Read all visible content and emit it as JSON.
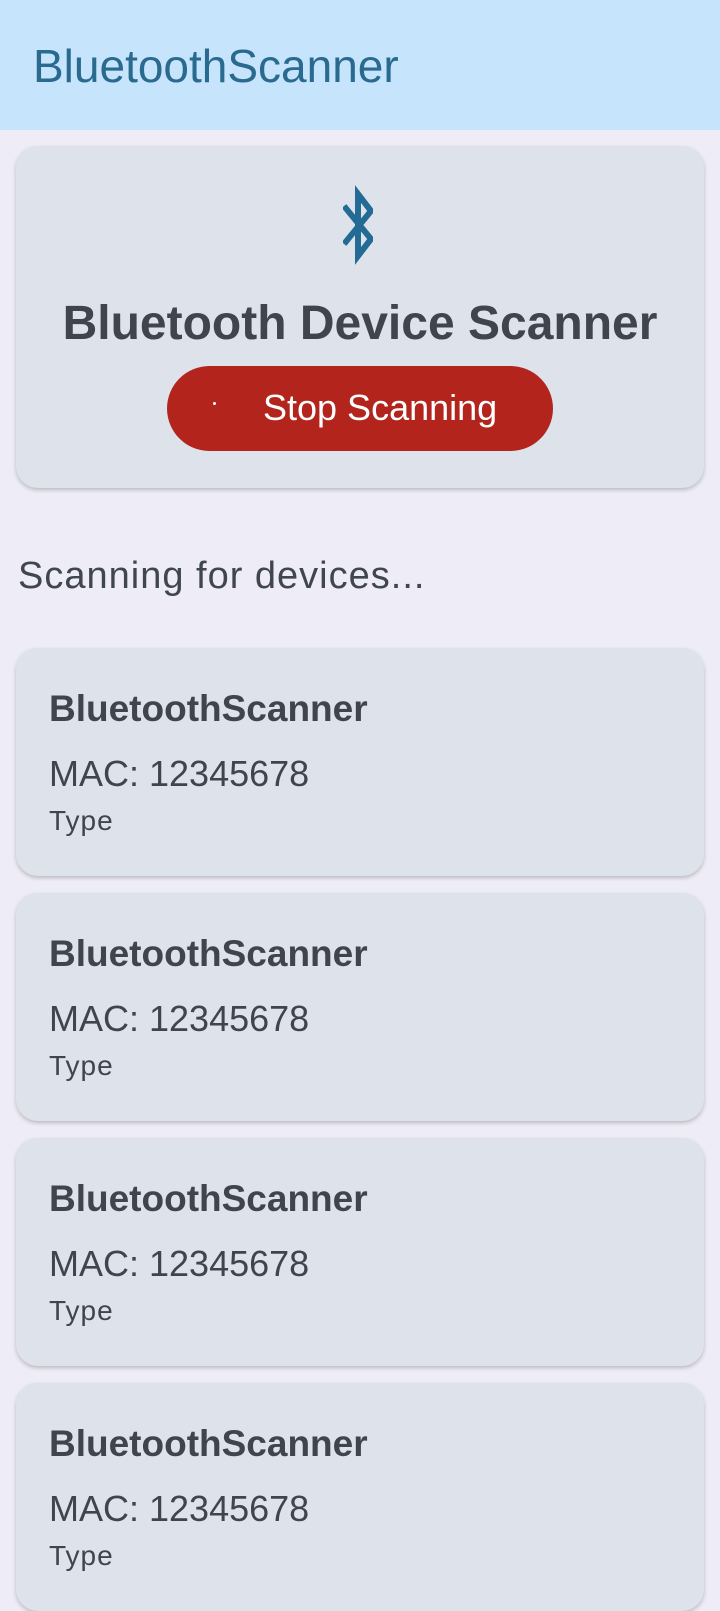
{
  "app_bar": {
    "title": "BluetoothScanner"
  },
  "header_card": {
    "icon": "bluetooth-icon",
    "title": "Bluetooth Device Scanner",
    "button_label": "Stop Scanning",
    "button_color": "#b3241d",
    "accent_color": "#236b94"
  },
  "status": {
    "text": "Scanning for devices..."
  },
  "devices": [
    {
      "name": "BluetoothScanner",
      "mac": "MAC: 12345678",
      "type": "Type"
    },
    {
      "name": "BluetoothScanner",
      "mac": "MAC: 12345678",
      "type": "Type"
    },
    {
      "name": "BluetoothScanner",
      "mac": "MAC: 12345678",
      "type": "Type"
    },
    {
      "name": "BluetoothScanner",
      "mac": "MAC: 12345678",
      "type": "Type"
    }
  ]
}
